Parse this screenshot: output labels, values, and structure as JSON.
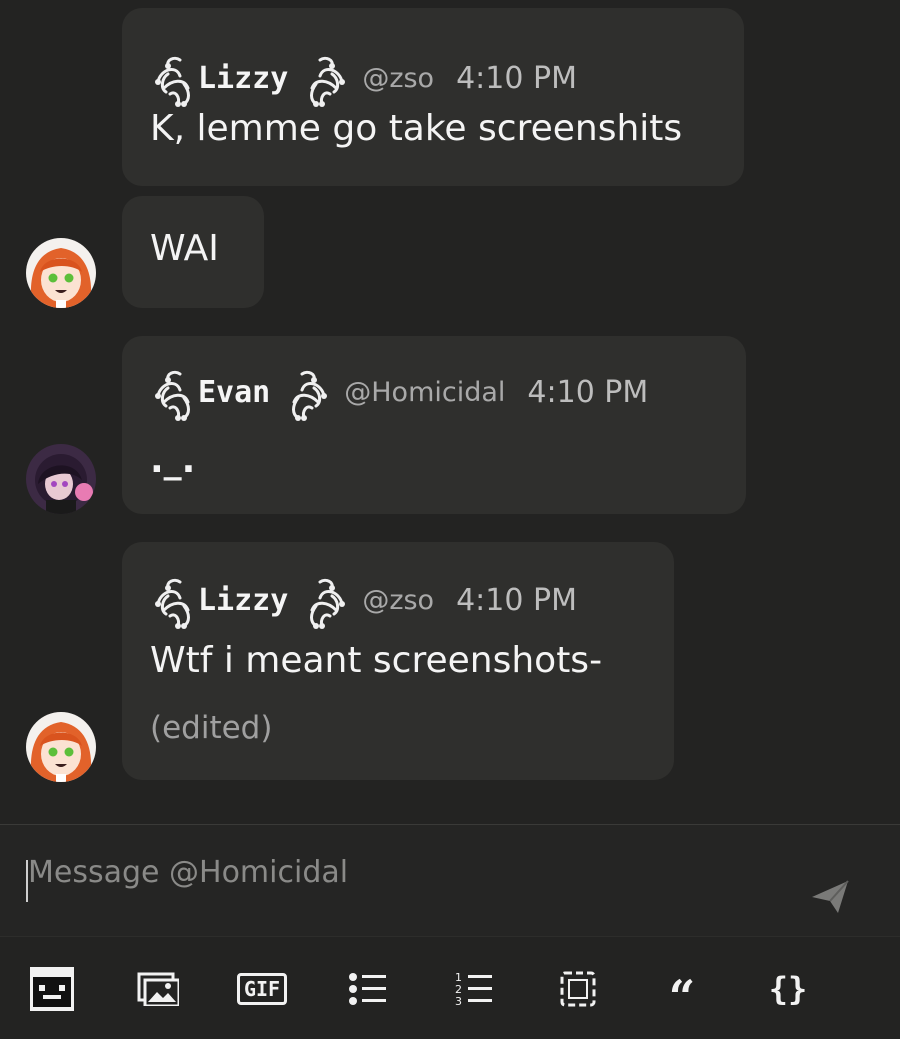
{
  "messages": [
    {
      "username": "Lizzy",
      "handle": "@zso",
      "time": "4:10 PM",
      "text": "K, lemme go take screenshits"
    },
    {
      "text": "WAI"
    },
    {
      "username": "Evan",
      "handle": "@Homicidal",
      "time": "4:10 PM",
      "text": "._."
    },
    {
      "username": "Lizzy",
      "handle": "@zso",
      "time": "4:10 PM",
      "text": "Wtf i meant screenshots-",
      "edited": "(edited)"
    }
  ],
  "composer": {
    "placeholder": "Message @Homicidal"
  },
  "toolbar": {
    "gif_label": "GIF",
    "quote_glyph": "“",
    "code_glyph": "{}"
  },
  "colors": {
    "background": "#232322",
    "bubble": "#2f2f2d",
    "text": "#f2f2f2",
    "muted": "#a9a9a9"
  }
}
